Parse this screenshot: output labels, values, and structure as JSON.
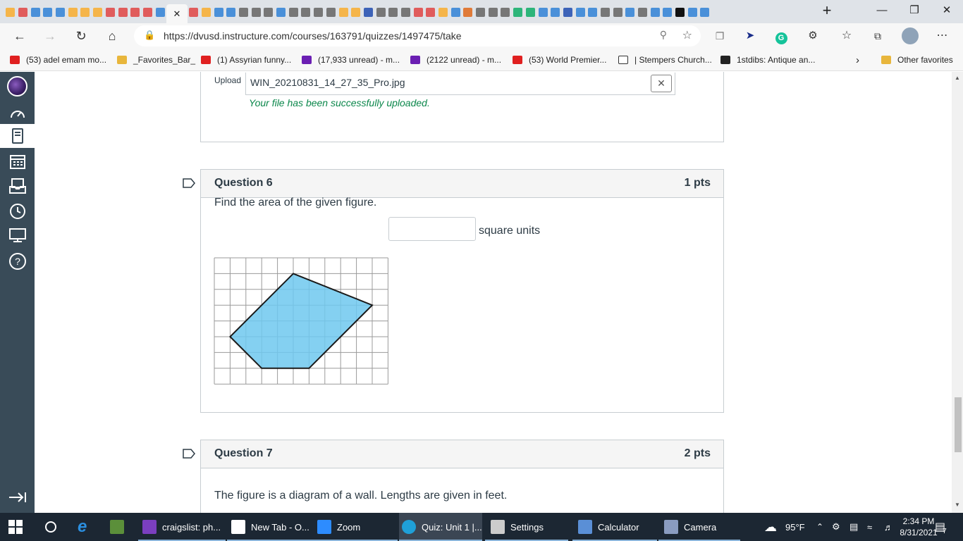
{
  "browser": {
    "tab_favicon_colors": [
      "#f5b54a",
      "#e05c5c",
      "#4a90d9",
      "#4a90d9",
      "#4a90d9",
      "#f5b54a",
      "#f5b54a",
      "#f5b54a",
      "#e05c5c",
      "#e05c5c",
      "#e05c5c",
      "#e05c5c",
      "#4a90d9",
      "#e05c5c",
      "#f5b54a",
      "#4a90d9",
      "#4a90d9",
      "#777777",
      "#777777",
      "#777777",
      "#4a90d9",
      "#777777",
      "#777777",
      "#777777",
      "#777777",
      "#f5b54a",
      "#f5b54a",
      "#3d63b8",
      "#777777",
      "#777777",
      "#777777",
      "#e05c5c",
      "#e05c5c",
      "#f5b54a",
      "#4a90d9",
      "#e07b39",
      "#777777",
      "#777777",
      "#777777",
      "#2db57a",
      "#2db57a",
      "#4a90d9",
      "#4a90d9",
      "#3d63b8",
      "#4a90d9",
      "#4a90d9",
      "#777777",
      "#777777",
      "#4a90d9",
      "#777777",
      "#4a90d9",
      "#4a90d9",
      "#111111",
      "#4a90d9",
      "#4a90d9"
    ],
    "close_tab_icon": "close-icon",
    "new_tab_icon": "plus-icon",
    "url": "https://dvusd.instructure.com/courses/163791/quizzes/1497475/take",
    "favorites": [
      {
        "label": "(53) adel emam mo...",
        "icon_color": "#e02020"
      },
      {
        "label": "_Favorites_Bar_",
        "icon_color": "#e8b63c"
      },
      {
        "label": "(1) Assyrian funny...",
        "icon_color": "#e02020"
      },
      {
        "label": "(17,933 unread) - m...",
        "icon_color": "#6b1fb3"
      },
      {
        "label": "(2122 unread) - m...",
        "icon_color": "#6b1fb3"
      },
      {
        "label": "(53) World Premier...",
        "icon_color": "#e02020"
      },
      {
        "label": "| Stempers Church...",
        "icon_color": "#ffffff"
      },
      {
        "label": "1stdibs: Antique an...",
        "icon_color": "#222222"
      },
      {
        "label": "Other favorites",
        "icon_color": "#e8b63c"
      }
    ]
  },
  "quiz": {
    "upload": {
      "label": "Upload",
      "filename": "WIN_20210831_14_27_35_Pro.jpg",
      "success_message": "Your file has been successfully uploaded."
    },
    "questions": [
      {
        "title": "Question 6",
        "points": "1 pts",
        "prompt": "Find the area of the given figure.",
        "answer_value": "",
        "units": "square units",
        "figure": {
          "grid_cols": 11,
          "grid_rows": 8,
          "polygon_grid_points": [
            [
              5,
              1
            ],
            [
              10,
              3
            ],
            [
              6,
              7
            ],
            [
              3,
              7
            ],
            [
              1,
              5
            ]
          ],
          "fill_color": "#6ec8ee"
        }
      },
      {
        "title": "Question 7",
        "points": "2 pts",
        "prompt": "The figure is a diagram of a wall. Lengths are given in feet."
      }
    ]
  },
  "taskbar": {
    "items": [
      {
        "label": "craigslist: ph...",
        "icon_color": "#7b3fbf"
      },
      {
        "label": "New Tab - O...",
        "icon_color": "#ffffff"
      },
      {
        "label": "Zoom",
        "icon_color": "#2d8cff"
      },
      {
        "label": "Quiz: Unit 1 |...",
        "icon_color": "#1fa0d8"
      },
      {
        "label": "Settings",
        "icon_color": "#cccccc"
      },
      {
        "label": "Calculator",
        "icon_color": "#5a8fd6"
      },
      {
        "label": "Camera",
        "icon_color": "#8a9cc0"
      }
    ],
    "weather": "95°F",
    "time": "2:34 PM",
    "date": "8/31/2021",
    "notifications": "7"
  }
}
